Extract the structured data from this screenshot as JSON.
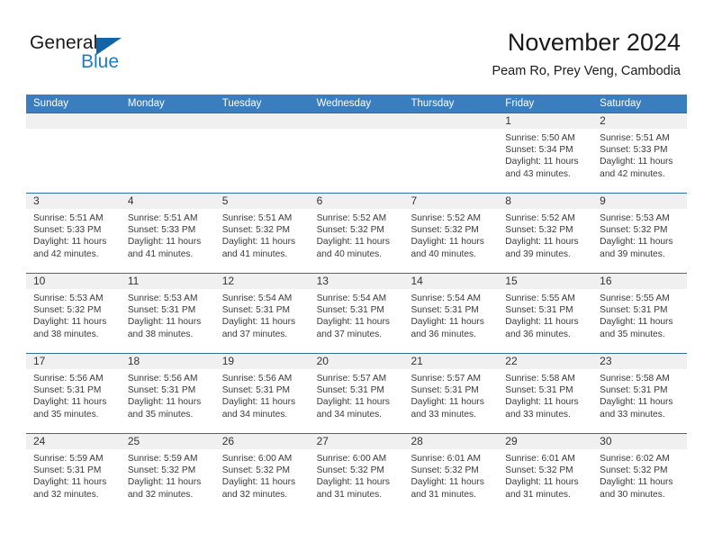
{
  "brand": {
    "name_part1": "General",
    "name_part2": "Blue",
    "logo_icon": "triangle-flag-icon",
    "accent_color": "#1f7cc4"
  },
  "header": {
    "title": "November 2024",
    "subtitle": "Peam Ro, Prey Veng, Cambodia"
  },
  "calendar": {
    "header_color": "#3a7ebf",
    "weekday_headers": [
      "Sunday",
      "Monday",
      "Tuesday",
      "Wednesday",
      "Thursday",
      "Friday",
      "Saturday"
    ],
    "weeks": [
      [
        {
          "day": "",
          "blank": true,
          "lines": []
        },
        {
          "day": "",
          "blank": true,
          "lines": []
        },
        {
          "day": "",
          "blank": true,
          "lines": []
        },
        {
          "day": "",
          "blank": true,
          "lines": []
        },
        {
          "day": "",
          "blank": true,
          "lines": []
        },
        {
          "day": "1",
          "blank": false,
          "lines": [
            "Sunrise: 5:50 AM",
            "Sunset: 5:34 PM",
            "Daylight: 11 hours",
            "and 43 minutes."
          ]
        },
        {
          "day": "2",
          "blank": false,
          "lines": [
            "Sunrise: 5:51 AM",
            "Sunset: 5:33 PM",
            "Daylight: 11 hours",
            "and 42 minutes."
          ]
        }
      ],
      [
        {
          "day": "3",
          "blank": false,
          "lines": [
            "Sunrise: 5:51 AM",
            "Sunset: 5:33 PM",
            "Daylight: 11 hours",
            "and 42 minutes."
          ]
        },
        {
          "day": "4",
          "blank": false,
          "lines": [
            "Sunrise: 5:51 AM",
            "Sunset: 5:33 PM",
            "Daylight: 11 hours",
            "and 41 minutes."
          ]
        },
        {
          "day": "5",
          "blank": false,
          "lines": [
            "Sunrise: 5:51 AM",
            "Sunset: 5:32 PM",
            "Daylight: 11 hours",
            "and 41 minutes."
          ]
        },
        {
          "day": "6",
          "blank": false,
          "lines": [
            "Sunrise: 5:52 AM",
            "Sunset: 5:32 PM",
            "Daylight: 11 hours",
            "and 40 minutes."
          ]
        },
        {
          "day": "7",
          "blank": false,
          "lines": [
            "Sunrise: 5:52 AM",
            "Sunset: 5:32 PM",
            "Daylight: 11 hours",
            "and 40 minutes."
          ]
        },
        {
          "day": "8",
          "blank": false,
          "lines": [
            "Sunrise: 5:52 AM",
            "Sunset: 5:32 PM",
            "Daylight: 11 hours",
            "and 39 minutes."
          ]
        },
        {
          "day": "9",
          "blank": false,
          "lines": [
            "Sunrise: 5:53 AM",
            "Sunset: 5:32 PM",
            "Daylight: 11 hours",
            "and 39 minutes."
          ]
        }
      ],
      [
        {
          "day": "10",
          "blank": false,
          "lines": [
            "Sunrise: 5:53 AM",
            "Sunset: 5:32 PM",
            "Daylight: 11 hours",
            "and 38 minutes."
          ]
        },
        {
          "day": "11",
          "blank": false,
          "lines": [
            "Sunrise: 5:53 AM",
            "Sunset: 5:31 PM",
            "Daylight: 11 hours",
            "and 38 minutes."
          ]
        },
        {
          "day": "12",
          "blank": false,
          "lines": [
            "Sunrise: 5:54 AM",
            "Sunset: 5:31 PM",
            "Daylight: 11 hours",
            "and 37 minutes."
          ]
        },
        {
          "day": "13",
          "blank": false,
          "lines": [
            "Sunrise: 5:54 AM",
            "Sunset: 5:31 PM",
            "Daylight: 11 hours",
            "and 37 minutes."
          ]
        },
        {
          "day": "14",
          "blank": false,
          "lines": [
            "Sunrise: 5:54 AM",
            "Sunset: 5:31 PM",
            "Daylight: 11 hours",
            "and 36 minutes."
          ]
        },
        {
          "day": "15",
          "blank": false,
          "lines": [
            "Sunrise: 5:55 AM",
            "Sunset: 5:31 PM",
            "Daylight: 11 hours",
            "and 36 minutes."
          ]
        },
        {
          "day": "16",
          "blank": false,
          "lines": [
            "Sunrise: 5:55 AM",
            "Sunset: 5:31 PM",
            "Daylight: 11 hours",
            "and 35 minutes."
          ]
        }
      ],
      [
        {
          "day": "17",
          "blank": false,
          "lines": [
            "Sunrise: 5:56 AM",
            "Sunset: 5:31 PM",
            "Daylight: 11 hours",
            "and 35 minutes."
          ]
        },
        {
          "day": "18",
          "blank": false,
          "lines": [
            "Sunrise: 5:56 AM",
            "Sunset: 5:31 PM",
            "Daylight: 11 hours",
            "and 35 minutes."
          ]
        },
        {
          "day": "19",
          "blank": false,
          "lines": [
            "Sunrise: 5:56 AM",
            "Sunset: 5:31 PM",
            "Daylight: 11 hours",
            "and 34 minutes."
          ]
        },
        {
          "day": "20",
          "blank": false,
          "lines": [
            "Sunrise: 5:57 AM",
            "Sunset: 5:31 PM",
            "Daylight: 11 hours",
            "and 34 minutes."
          ]
        },
        {
          "day": "21",
          "blank": false,
          "lines": [
            "Sunrise: 5:57 AM",
            "Sunset: 5:31 PM",
            "Daylight: 11 hours",
            "and 33 minutes."
          ]
        },
        {
          "day": "22",
          "blank": false,
          "lines": [
            "Sunrise: 5:58 AM",
            "Sunset: 5:31 PM",
            "Daylight: 11 hours",
            "and 33 minutes."
          ]
        },
        {
          "day": "23",
          "blank": false,
          "lines": [
            "Sunrise: 5:58 AM",
            "Sunset: 5:31 PM",
            "Daylight: 11 hours",
            "and 33 minutes."
          ]
        }
      ],
      [
        {
          "day": "24",
          "blank": false,
          "lines": [
            "Sunrise: 5:59 AM",
            "Sunset: 5:31 PM",
            "Daylight: 11 hours",
            "and 32 minutes."
          ]
        },
        {
          "day": "25",
          "blank": false,
          "lines": [
            "Sunrise: 5:59 AM",
            "Sunset: 5:32 PM",
            "Daylight: 11 hours",
            "and 32 minutes."
          ]
        },
        {
          "day": "26",
          "blank": false,
          "lines": [
            "Sunrise: 6:00 AM",
            "Sunset: 5:32 PM",
            "Daylight: 11 hours",
            "and 32 minutes."
          ]
        },
        {
          "day": "27",
          "blank": false,
          "lines": [
            "Sunrise: 6:00 AM",
            "Sunset: 5:32 PM",
            "Daylight: 11 hours",
            "and 31 minutes."
          ]
        },
        {
          "day": "28",
          "blank": false,
          "lines": [
            "Sunrise: 6:01 AM",
            "Sunset: 5:32 PM",
            "Daylight: 11 hours",
            "and 31 minutes."
          ]
        },
        {
          "day": "29",
          "blank": false,
          "lines": [
            "Sunrise: 6:01 AM",
            "Sunset: 5:32 PM",
            "Daylight: 11 hours",
            "and 31 minutes."
          ]
        },
        {
          "day": "30",
          "blank": false,
          "lines": [
            "Sunrise: 6:02 AM",
            "Sunset: 5:32 PM",
            "Daylight: 11 hours",
            "and 30 minutes."
          ]
        }
      ]
    ]
  }
}
